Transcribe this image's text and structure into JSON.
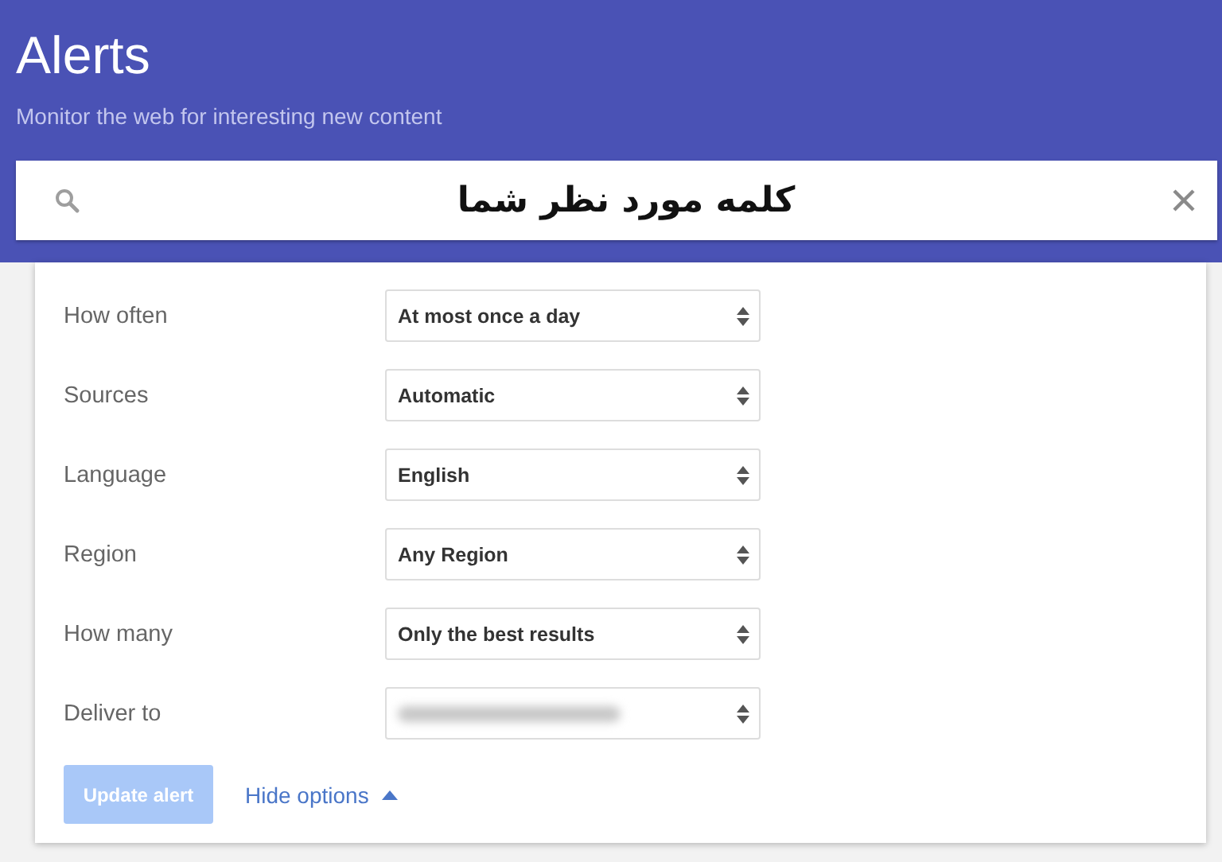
{
  "header": {
    "title": "Alerts",
    "subtitle": "Monitor the web for interesting new content"
  },
  "search": {
    "value": "کلمه مورد نظر شما"
  },
  "options": [
    {
      "label": "How often",
      "value": "At most once a day",
      "blurred": false
    },
    {
      "label": "Sources",
      "value": "Automatic",
      "blurred": false
    },
    {
      "label": "Language",
      "value": "English",
      "blurred": false
    },
    {
      "label": "Region",
      "value": "Any Region",
      "blurred": false
    },
    {
      "label": "How many",
      "value": "Only the best results",
      "blurred": false
    },
    {
      "label": "Deliver to",
      "blurred": true
    }
  ],
  "update_button": {
    "label": "Update alert",
    "disabled": true
  },
  "hide_options_link": {
    "label": "Hide options",
    "expanded": true
  }
}
